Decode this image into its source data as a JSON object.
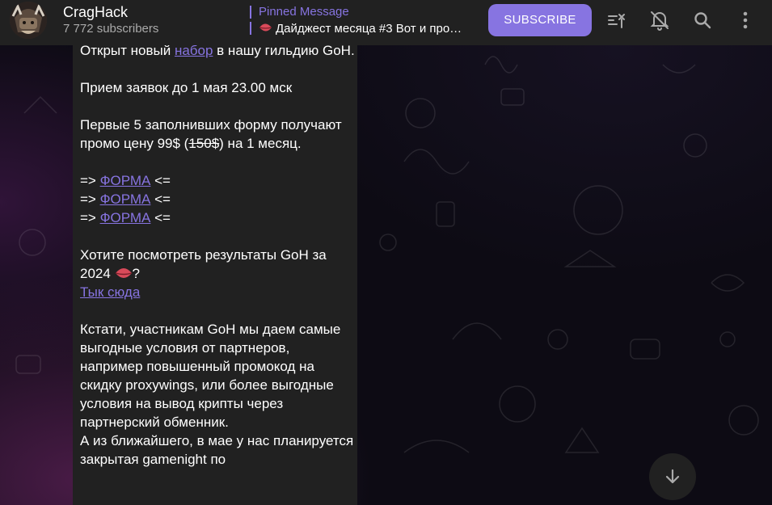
{
  "header": {
    "title": "CragHack",
    "subscribers": "7 772 subscribers",
    "pinned_label": "Pinned Message",
    "pinned_text": "Дайджест месяца #3 Вот и про…",
    "subscribe_label": "SUBSCRIBE",
    "icons": [
      "boost-icon",
      "bell-muted-icon",
      "search-icon",
      "more-vertical-icon"
    ]
  },
  "message": {
    "l1_before": "Открыт новый ",
    "l1_link": "набор",
    "l1_after": " в нашу гильдию GoH.",
    "l2": "Прием заявок до 1 мая 23.00 мск",
    "l3_before": "Первые 5 заполнивших форму получают промо цену 99$ (",
    "l3_strike": "150$",
    "l3_after": ") на 1 месяц.",
    "form_prefix": "=> ",
    "form_link": "ФОРМА",
    "form_suffix": " <=",
    "l5_text": "Хотите посмотреть результаты GoH за 2024 ",
    "l5_end": "?",
    "l5_link": "Тык сюда",
    "l6": "Кстати, участникам GoH мы даем самые выгодные условия от партнеров, например повышенный промокод на скидку proxywings, или более выгодные условия на вывод крипты через партнерский обменник.",
    "l7": "А из ближайшего, в мае у нас планируется закрытая gamenight по"
  },
  "colors": {
    "accent": "#8774e1",
    "header_bg": "#212121",
    "bubble_bg": "#212121"
  }
}
